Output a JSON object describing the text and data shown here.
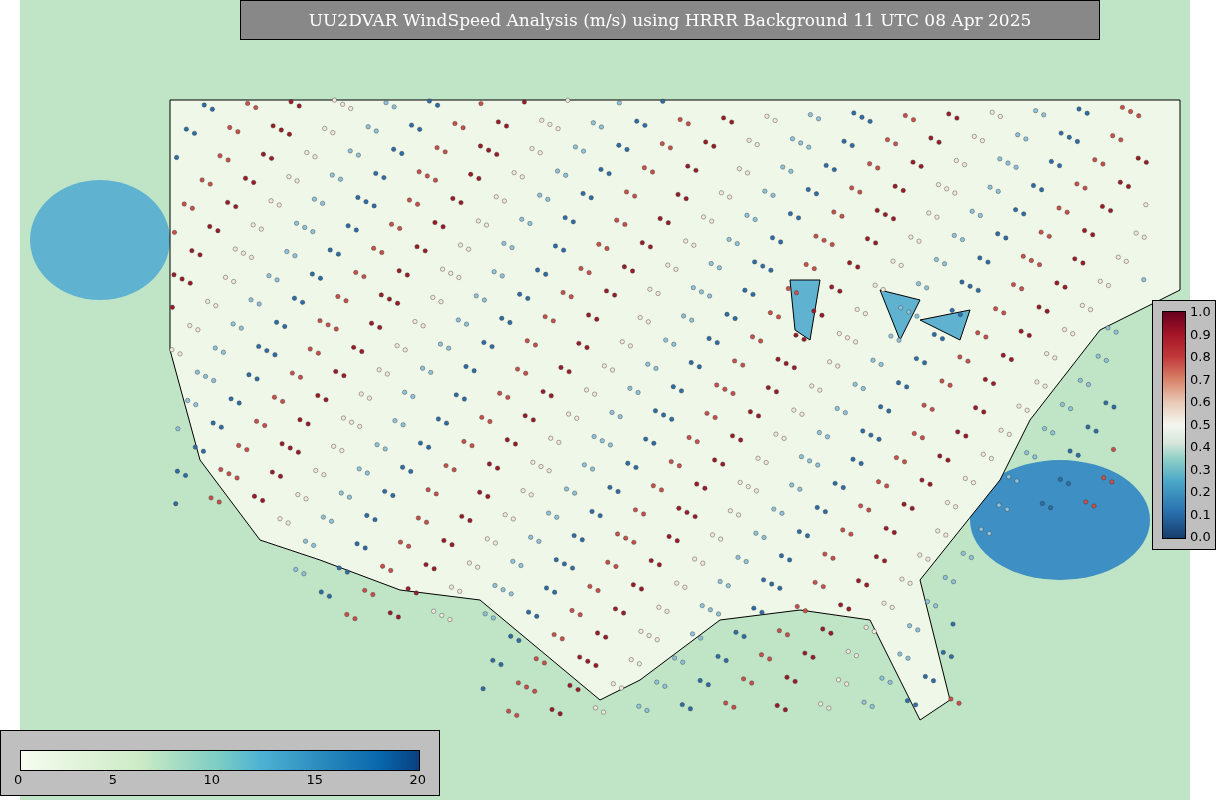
{
  "title": "UU2DVAR WindSpeed Analysis (m/s) using HRRR Background 11 UTC 08 Apr 2025",
  "side_colorbar": {
    "ticks": [
      "1.0",
      "0.9",
      "0.8",
      "0.7",
      "0.6",
      "0.5",
      "0.4",
      "0.3",
      "0.2",
      "0.1",
      "0.0"
    ]
  },
  "bottom_colorbar": {
    "ticks": [
      "0",
      "5",
      "10",
      "15",
      "20"
    ]
  }
}
